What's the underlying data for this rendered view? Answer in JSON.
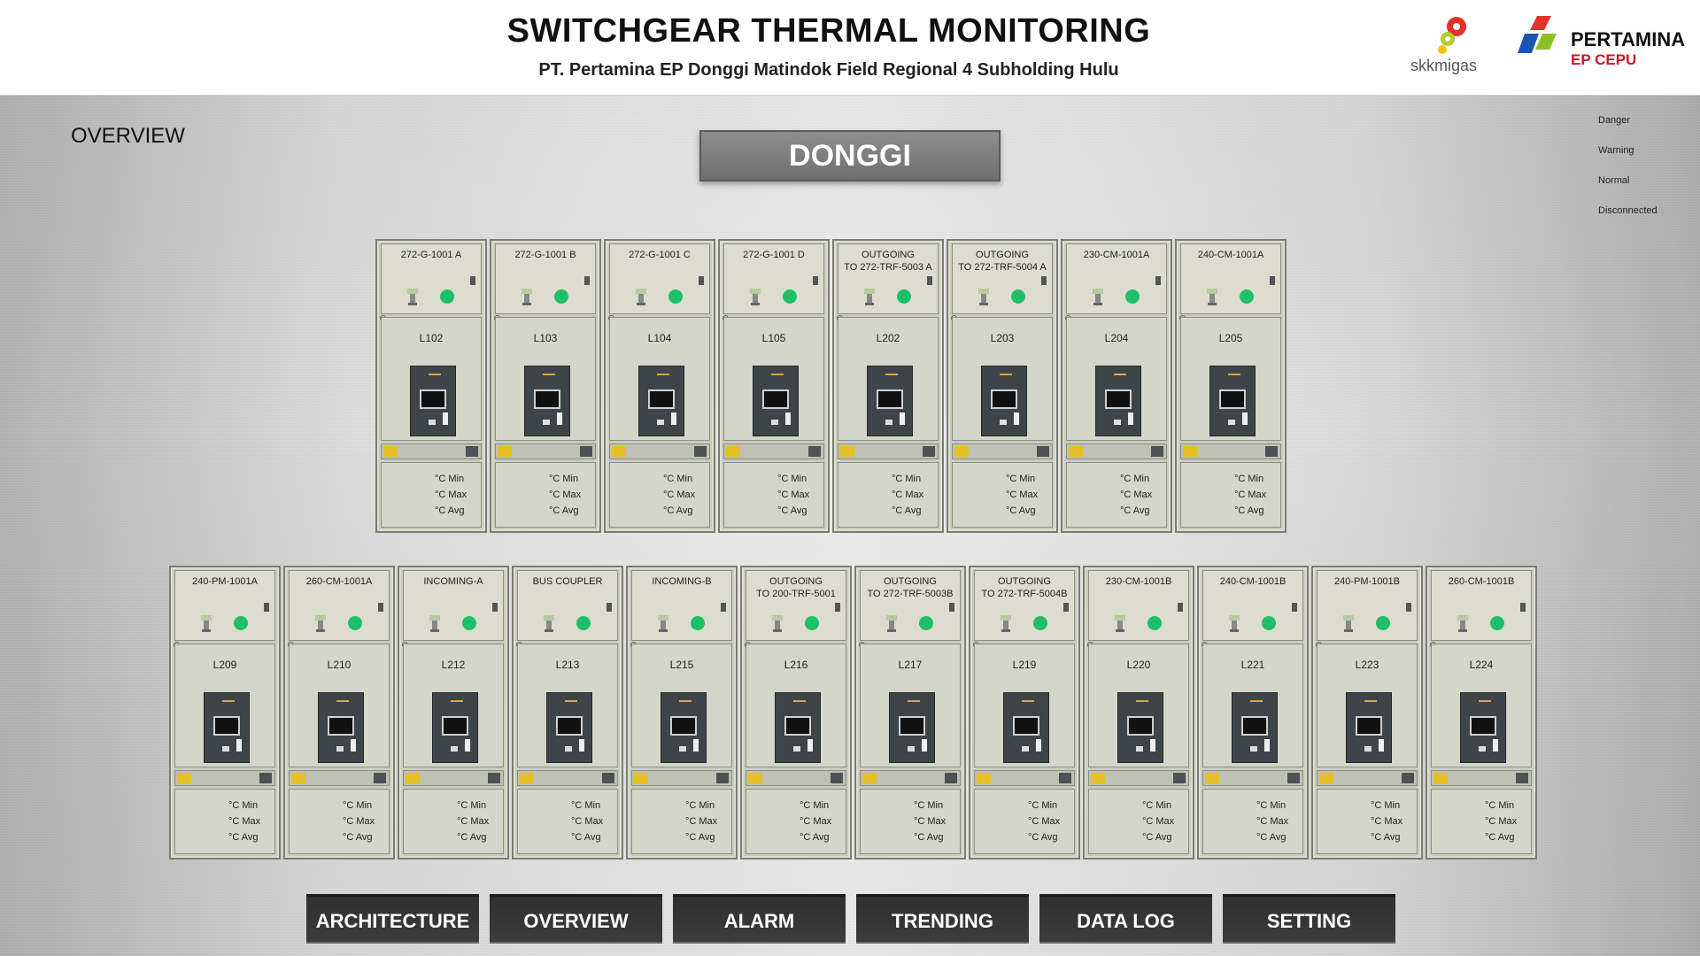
{
  "header": {
    "title": "SWITCHGEAR THERMAL MONITORING",
    "subtitle": "PT. Pertamina EP Donggi Matindok Field Regional 4 Subholding Hulu",
    "logo_skk_text": "skkmigas",
    "logo_pertamina_name": "PERTAMINA",
    "logo_pertamina_sub": "EP CEPU"
  },
  "page_label": "OVERVIEW",
  "area": "DONGGI",
  "legend": [
    "Danger",
    "Warning",
    "Normal",
    "Disconnected"
  ],
  "temp_labels": {
    "min": "°C Min",
    "max": "°C Max",
    "avg": "°C Avg"
  },
  "top_row": [
    {
      "name": "272-G-1001 A",
      "code": "L102"
    },
    {
      "name": "272-G-1001 B",
      "code": "L103"
    },
    {
      "name": "272-G-1001 C",
      "code": "L104"
    },
    {
      "name": "272-G-1001 D",
      "code": "L105"
    },
    {
      "name": "OUTGOING\nTO 272-TRF-5003 A",
      "code": "L202"
    },
    {
      "name": "OUTGOING\nTO 272-TRF-5004 A",
      "code": "L203"
    },
    {
      "name": "230-CM-1001A",
      "code": "L204"
    },
    {
      "name": "240-CM-1001A",
      "code": "L205"
    }
  ],
  "bottom_row": [
    {
      "name": "240-PM-1001A",
      "code": "L209"
    },
    {
      "name": "260-CM-1001A",
      "code": "L210"
    },
    {
      "name": "INCOMING-A",
      "code": "L212"
    },
    {
      "name": "BUS COUPLER",
      "code": "L213"
    },
    {
      "name": "INCOMING-B",
      "code": "L215"
    },
    {
      "name": "OUTGOING\nTO 200-TRF-5001",
      "code": "L216"
    },
    {
      "name": "OUTGOING\nTO 272-TRF-5003B",
      "code": "L217"
    },
    {
      "name": "OUTGOING\nTO 272-TRF-5004B",
      "code": "L219"
    },
    {
      "name": "230-CM-1001B",
      "code": "L220"
    },
    {
      "name": "240-CM-1001B",
      "code": "L221"
    },
    {
      "name": "240-PM-1001B",
      "code": "L223"
    },
    {
      "name": "260-CM-1001B",
      "code": "L224"
    }
  ],
  "nav": [
    "ARCHITECTURE",
    "OVERVIEW",
    "ALARM",
    "TRENDING",
    "DATA LOG",
    "SETTING"
  ],
  "colors": {
    "status_normal": "#1fbf6a",
    "nav_bg": "#333333"
  }
}
